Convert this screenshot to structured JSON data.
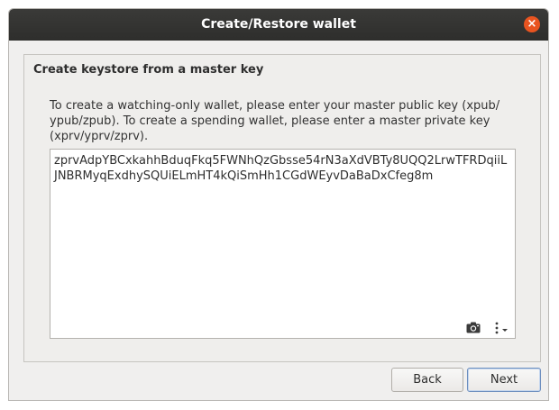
{
  "window": {
    "title": "Create/Restore wallet",
    "close_glyph": "×"
  },
  "panel": {
    "title": "Create keystore from a master key",
    "instructions": "To create a watching-only wallet, please enter your master public key (xpub/ ypub/zpub). To create a spending wallet, please enter a master private key (xprv/yprv/zprv).",
    "key_value": "zprvAdpYBCxkahhBduqFkq5FWNhQzGbsse54rN3aXdVBTy8UQQ2LrwTFRDqiiLJNBRMyqExdhySQUiELmHT4kQiSmHh1CGdWEyvDaBaDxCfeg8m"
  },
  "buttons": {
    "back_label": "Back",
    "next_label": "Next"
  },
  "icons": {
    "close": "close-icon",
    "camera": "camera-icon",
    "menu": "kebab-menu-icon"
  },
  "colors": {
    "titlebar": "#2e2e2c",
    "close_button": "#e95420",
    "window_bg": "#f0efee",
    "default_button_border": "#6d8fbf"
  }
}
